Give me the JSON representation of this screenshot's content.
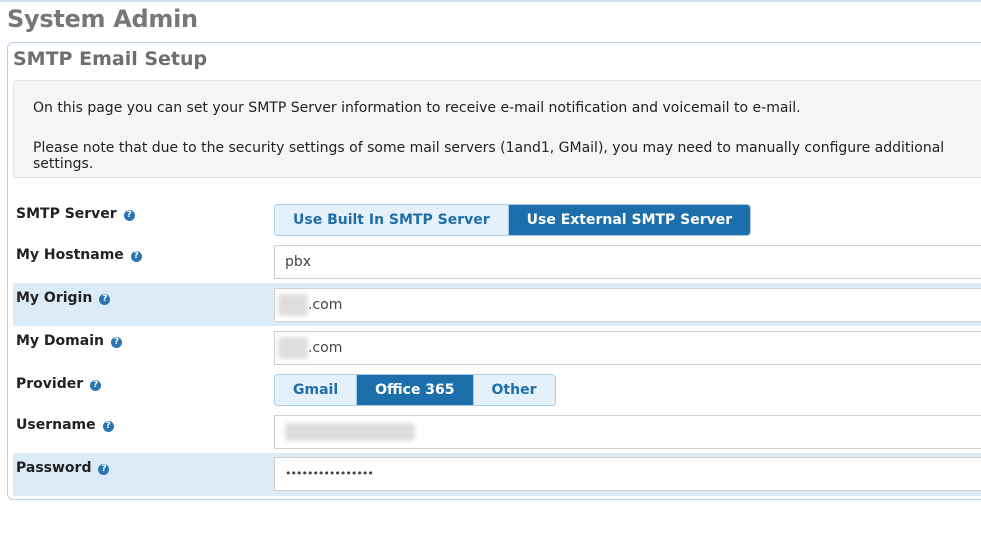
{
  "page": {
    "title": "System Admin"
  },
  "panel": {
    "title": "SMTP Email Setup",
    "info_line1": "On this page you can set your SMTP Server information to receive e-mail notification and voicemail to e-mail.",
    "info_line2": "Please note that due to the security settings of some mail servers (1and1, GMail), you may need to manually configure additional settings."
  },
  "form": {
    "smtp_server": {
      "label": "SMTP Server",
      "options": [
        "Use Built In SMTP Server",
        "Use External SMTP Server"
      ],
      "selected": "Use External SMTP Server"
    },
    "hostname": {
      "label": "My Hostname",
      "value": "pbx"
    },
    "origin": {
      "label": "My Origin",
      "value_suffix": ".com"
    },
    "domain": {
      "label": "My Domain",
      "value_suffix": ".com"
    },
    "provider": {
      "label": "Provider",
      "options": [
        "Gmail",
        "Office 365",
        "Other"
      ],
      "selected": "Office 365"
    },
    "username": {
      "label": "Username"
    },
    "password": {
      "label": "Password",
      "value": "••••••••••••••••"
    }
  },
  "icons": {
    "help": "question-circle-icon",
    "help_glyph": "?"
  },
  "colors": {
    "accent": "#1d6fab",
    "highlight_row": "#dcebf8"
  }
}
